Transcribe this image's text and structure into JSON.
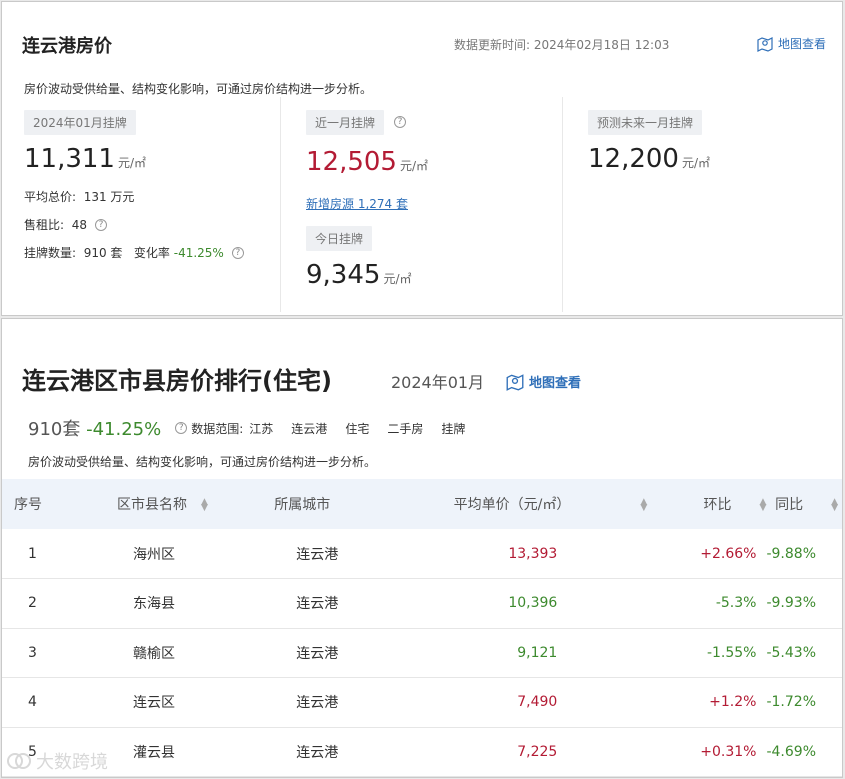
{
  "top": {
    "title": "连云港房价",
    "update_time": "数据更新时间:  2024年02月18日 12:03",
    "map_link": "地图查看",
    "note": "房价波动受供给量、结构变化影响，可通过房价结构进一步分析。",
    "col1": {
      "tag": "2024年01月挂牌",
      "price": "11,311",
      "unit": "元/㎡",
      "avg_total_label": "平均总价:",
      "avg_total_value": "131",
      "avg_total_unit": "万元",
      "rent_ratio_label": "售租比:",
      "rent_ratio_value": "48",
      "listing_label": "挂牌数量:",
      "listing_value": "910",
      "listing_unit": "套",
      "change_label": "变化率",
      "change_value": "-41.25%"
    },
    "col2": {
      "tag": "近一月挂牌",
      "price": "12,505",
      "unit": "元/㎡",
      "new_listings": "新增房源 1,274 套",
      "today_tag": "今日挂牌",
      "today_price": "9,345",
      "today_unit": "元/㎡"
    },
    "col3": {
      "tag": "预测未来一月挂牌",
      "price": "12,200",
      "unit": "元/㎡"
    }
  },
  "bottom": {
    "title": "连云港区市县房价排行(住宅)",
    "date": "2024年01月",
    "map_link": "地图查看",
    "count": "910套",
    "change": "-41.25%",
    "range_label": "数据范围:",
    "range": [
      "江苏",
      "连云港",
      "住宅",
      "二手房",
      "挂牌"
    ],
    "note": "房价波动受供给量、结构变化影响，可通过房价结构进一步分析。",
    "columns": [
      "序号",
      "区市县名称",
      "所属城市",
      "平均单价（元/㎡）",
      "环比",
      "同比"
    ],
    "rows": [
      {
        "no": "1",
        "name": "海州区",
        "city": "连云港",
        "price": "13,393",
        "mom": "+2.66%",
        "yoy": "-9.88%"
      },
      {
        "no": "2",
        "name": "东海县",
        "city": "连云港",
        "price": "10,396",
        "mom": "-5.3%",
        "yoy": "-9.93%"
      },
      {
        "no": "3",
        "name": "赣榆区",
        "city": "连云港",
        "price": "9,121",
        "mom": "-1.55%",
        "yoy": "-5.43%"
      },
      {
        "no": "4",
        "name": "连云区",
        "city": "连云港",
        "price": "7,490",
        "mom": "+1.2%",
        "yoy": "-1.72%"
      },
      {
        "no": "5",
        "name": "灌云县",
        "city": "连云港",
        "price": "7,225",
        "mom": "+0.31%",
        "yoy": "-4.69%"
      }
    ]
  },
  "watermark": "大数跨境",
  "colors": {
    "red": "#b31b34",
    "green": "#3d8a2e",
    "link": "#2f6fb8",
    "header_bg": "#eef3fa"
  }
}
